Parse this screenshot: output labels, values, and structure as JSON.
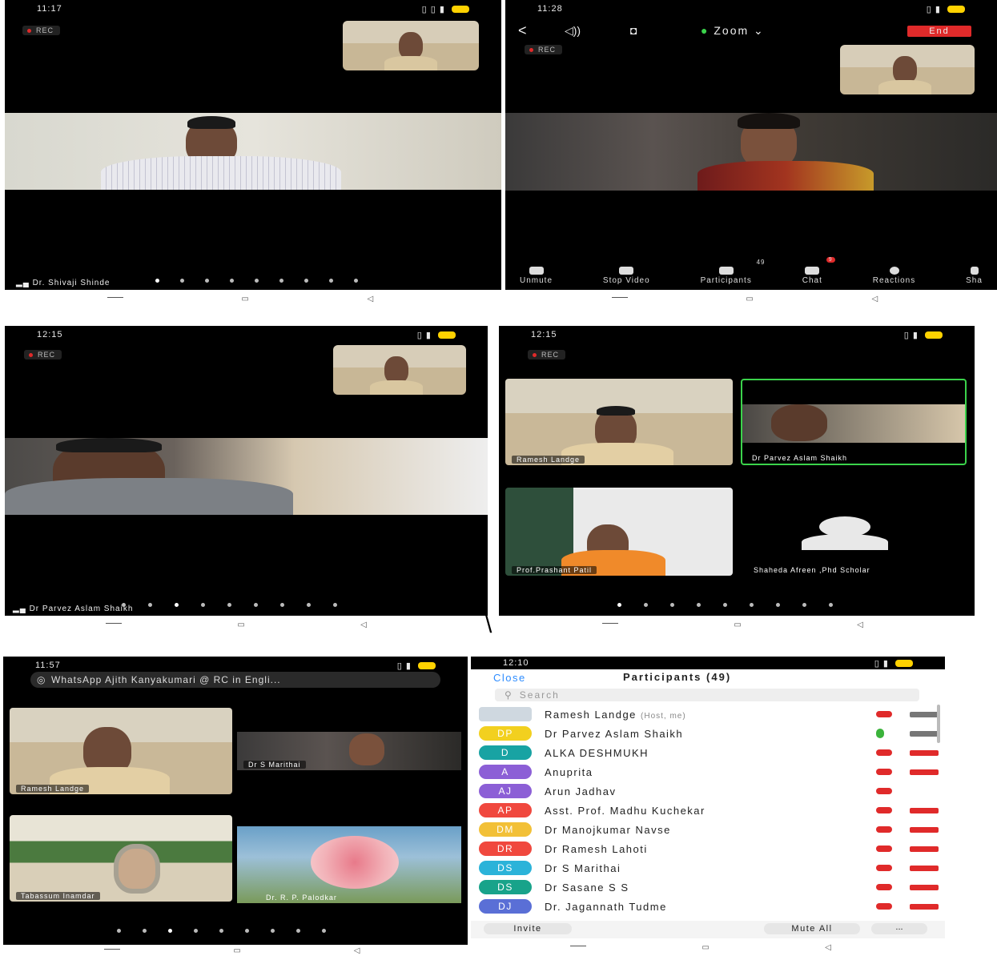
{
  "colors": {
    "accent": "#2d8cff",
    "danger": "#e02a2a",
    "active_border": "#3bd34b",
    "status_battery": "#ffd200"
  },
  "panel1": {
    "time": "11:17",
    "rec": "REC",
    "speaker_name": "Dr. Shivaji Shinde",
    "page_dots": 9,
    "active_dot": 0
  },
  "panel2": {
    "time": "11:28",
    "rec": "REC",
    "meeting_label": "Zoom",
    "end_label": "End",
    "toolbar": [
      {
        "label": "Unmute",
        "icon": "mic-muted-icon"
      },
      {
        "label": "Stop Video",
        "icon": "video-camera-icon"
      },
      {
        "label": "Participants",
        "icon": "participants-icon",
        "badge": "49"
      },
      {
        "label": "Chat",
        "icon": "chat-icon",
        "badge": "9"
      },
      {
        "label": "Reactions",
        "icon": "reactions-icon"
      },
      {
        "label": "Sha",
        "icon": "share-icon"
      }
    ]
  },
  "panel3": {
    "time": "12:15",
    "rec": "REC",
    "speaker_name": "Dr Parvez Aslam Shaikh",
    "page_dots": 9,
    "active_dot": 2
  },
  "panel4": {
    "time": "12:15",
    "rec": "REC",
    "tiles": [
      "Ramesh Landge",
      "Dr Parvez Aslam Shaikh",
      "Prof.Prashant Patil",
      "Shaheda Afreen ,Phd Scholar"
    ],
    "page_dots": 9,
    "active_dot": 0
  },
  "separator_glyph": "\\",
  "panel5": {
    "time": "11:57",
    "rec": "REC",
    "notification": "WhatsApp   Ajith Kanyakumari @ RC in Engli...",
    "tiles": [
      "Ramesh Landge",
      "Dr S Marithai",
      "Tabassum Inamdar",
      "Dr. R. P. Palodkar"
    ],
    "page_dots": 9,
    "active_dot": 2
  },
  "panel6": {
    "time": "12:10",
    "close_label": "Close",
    "title": "Participants (49)",
    "search_placeholder": "Search",
    "participants": [
      {
        "initials": "",
        "name": "Ramesh Landge",
        "host": "(Host, me)",
        "color": "#cfd8e0",
        "mic": "muted",
        "cam": "off-grey"
      },
      {
        "initials": "DP",
        "name": "Dr Parvez Aslam Shaikh",
        "host": "",
        "color": "#f2d01f",
        "mic": "on",
        "cam": "off-grey"
      },
      {
        "initials": "D",
        "name": "ALKA DESHMUKH",
        "host": "",
        "color": "#18a3a3",
        "mic": "muted",
        "cam": "muted"
      },
      {
        "initials": "A",
        "name": "Anuprita",
        "host": "",
        "color": "#8c5fd6",
        "mic": "muted",
        "cam": "muted"
      },
      {
        "initials": "AJ",
        "name": "Arun Jadhav",
        "host": "",
        "color": "#8c5fd6",
        "mic": "muted",
        "cam": "none"
      },
      {
        "initials": "AP",
        "name": "Asst. Prof. Madhu Kuchekar",
        "host": "",
        "color": "#f0483e",
        "mic": "muted",
        "cam": "muted"
      },
      {
        "initials": "DM",
        "name": "Dr Manojkumar Navse",
        "host": "",
        "color": "#f2c037",
        "mic": "muted",
        "cam": "muted"
      },
      {
        "initials": "DR",
        "name": "Dr Ramesh Lahoti",
        "host": "",
        "color": "#f0483e",
        "mic": "muted",
        "cam": "muted"
      },
      {
        "initials": "DS",
        "name": "Dr S Marithai",
        "host": "",
        "color": "#2bb3d9",
        "mic": "muted",
        "cam": "muted"
      },
      {
        "initials": "DS",
        "name": "Dr Sasane S S",
        "host": "",
        "color": "#18a38a",
        "mic": "muted",
        "cam": "muted"
      },
      {
        "initials": "DJ",
        "name": "Dr. Jagannath Tudme",
        "host": "",
        "color": "#5a6fd6",
        "mic": "muted",
        "cam": "muted"
      }
    ],
    "invite_label": "Invite",
    "mute_all_label": "Mute All",
    "more_label": "..."
  }
}
